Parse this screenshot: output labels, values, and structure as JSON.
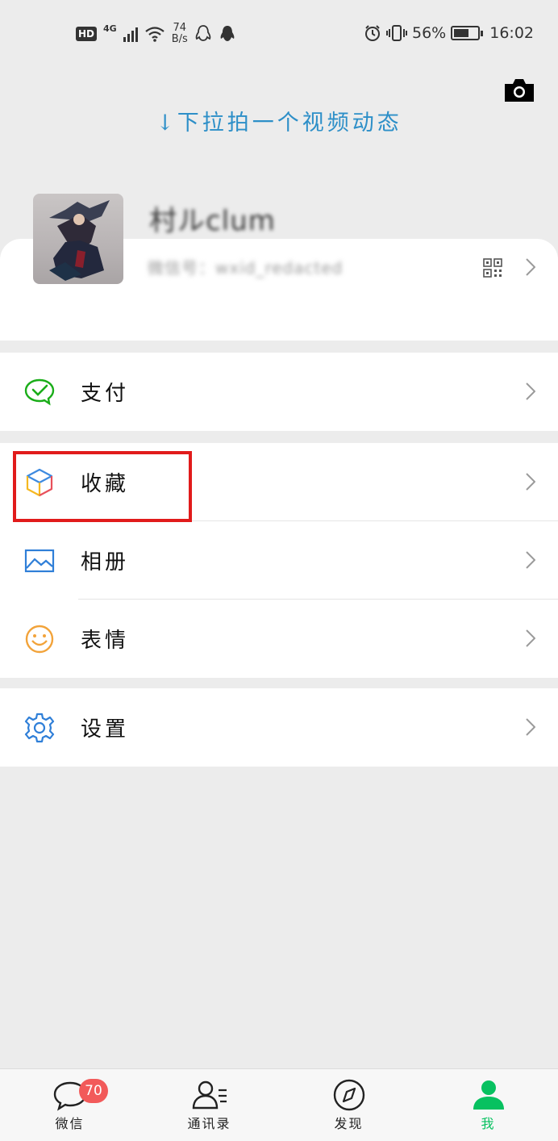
{
  "status_bar": {
    "hd": "HD",
    "network": "4G",
    "speed_value": "74",
    "speed_unit": "B/s",
    "battery_percent": "56%",
    "battery_level": 0.56,
    "time": "16:02"
  },
  "header": {
    "pull_hint": "↓下拉拍一个视频动态"
  },
  "profile": {
    "nickname": "村ルclum",
    "wechat_id": "微信号：wxid_redacted"
  },
  "menu": {
    "group1": [
      {
        "label": "支付",
        "icon": "wechat-pay-icon"
      }
    ],
    "group2": [
      {
        "label": "收藏",
        "icon": "favorites-cube-icon"
      },
      {
        "label": "相册",
        "icon": "album-icon"
      },
      {
        "label": "表情",
        "icon": "sticker-smile-icon"
      }
    ],
    "group3": [
      {
        "label": "设置",
        "icon": "settings-gear-icon"
      }
    ]
  },
  "tabbar": {
    "tabs": [
      {
        "label": "微信",
        "badge": "70",
        "icon": "chat-bubble-icon"
      },
      {
        "label": "通讯录",
        "icon": "contacts-icon"
      },
      {
        "label": "发现",
        "icon": "compass-icon"
      },
      {
        "label": "我",
        "icon": "me-person-icon",
        "active": true
      }
    ]
  },
  "colors": {
    "accent_green": "#07c160",
    "hint_blue": "#2d8fc8",
    "highlight_red": "#e11b1b",
    "badge_red": "#f25a5a"
  }
}
